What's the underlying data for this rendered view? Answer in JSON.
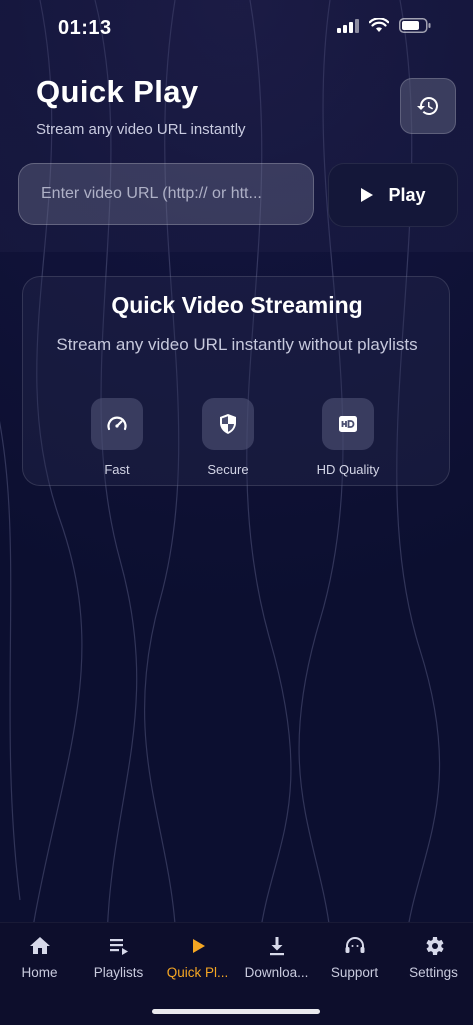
{
  "status_bar": {
    "time": "01:13",
    "icons": [
      "signal-icon",
      "wifi-icon",
      "battery-icon"
    ]
  },
  "header": {
    "title": "Quick Play",
    "subtitle": "Stream any video URL instantly",
    "history_icon": "history-icon"
  },
  "url_form": {
    "placeholder": "Enter video URL (http:// or htt...",
    "value": "",
    "play_label": "Play"
  },
  "feature_card": {
    "title": "Quick Video Streaming",
    "description": "Stream any video URL instantly without playlists",
    "features": [
      {
        "label": "Fast",
        "icon": "speedometer-icon"
      },
      {
        "label": "Secure",
        "icon": "shield-icon"
      },
      {
        "label": "HD Quality",
        "icon": "hd-icon"
      }
    ]
  },
  "tabs": [
    {
      "label": "Home",
      "icon": "home-icon",
      "active": false
    },
    {
      "label": "Playlists",
      "icon": "playlist-icon",
      "active": false
    },
    {
      "label": "Quick Pl...",
      "icon": "play-icon",
      "active": true
    },
    {
      "label": "Downloa...",
      "icon": "download-icon",
      "active": false
    },
    {
      "label": "Support",
      "icon": "support-icon",
      "active": false
    },
    {
      "label": "Settings",
      "icon": "gear-icon",
      "active": false
    }
  ],
  "colors": {
    "accent": "#f5a623",
    "background": "#11133a",
    "tabbar": "#0d0e2c"
  }
}
